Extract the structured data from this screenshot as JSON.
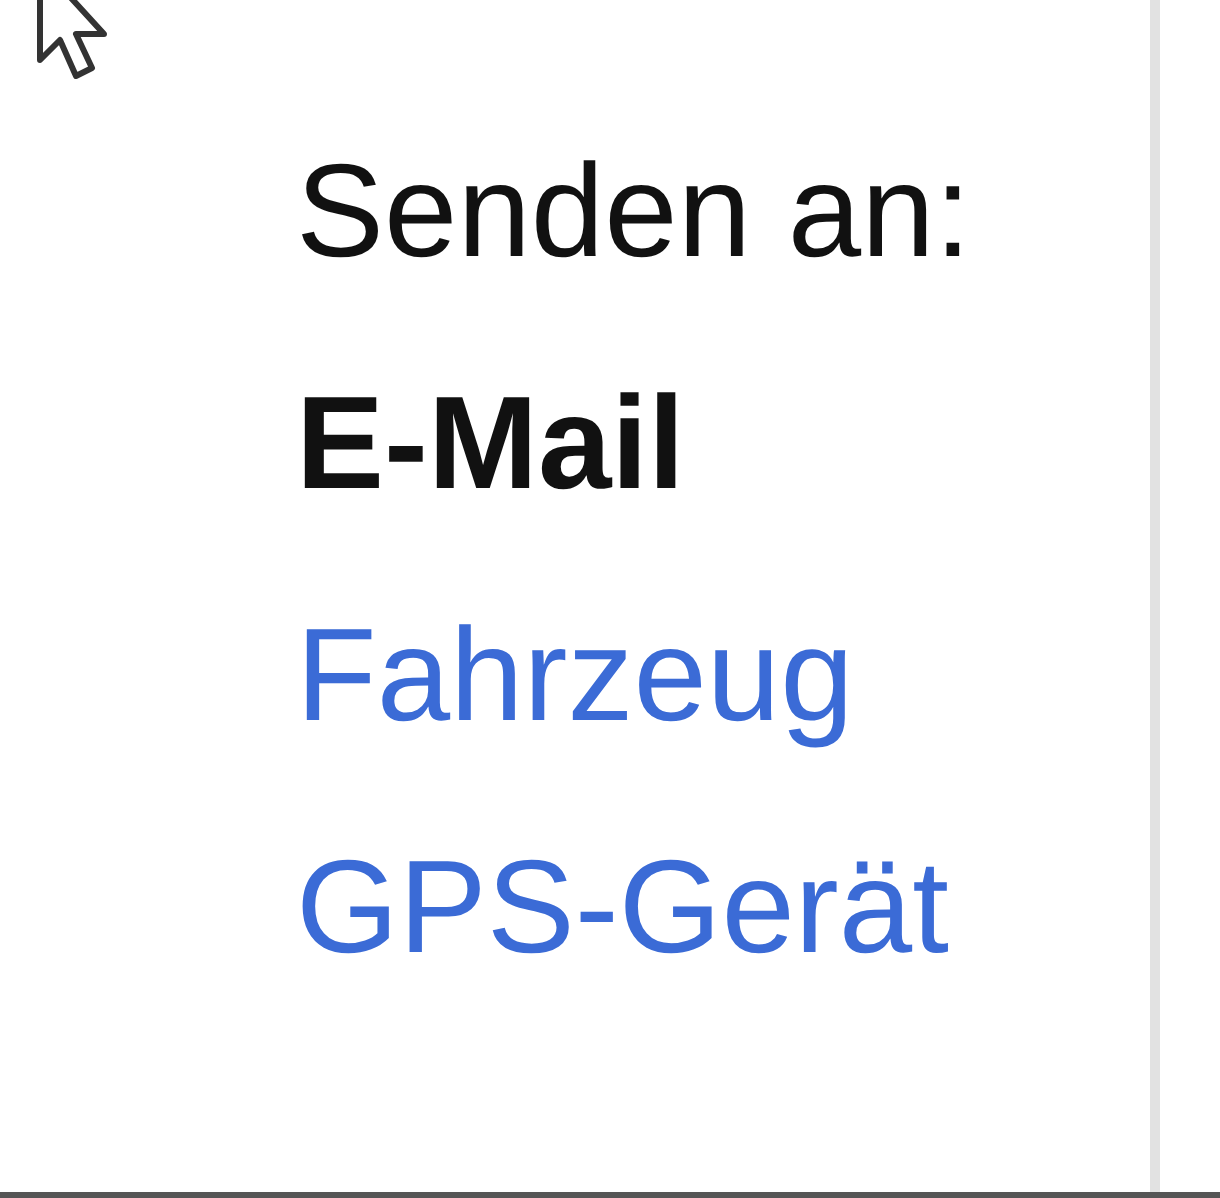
{
  "heading": "Senden an:",
  "options": [
    {
      "label": "E-Mail",
      "selected": true
    },
    {
      "label": "Fahrzeug",
      "selected": false
    },
    {
      "label": "GPS-Gerät",
      "selected": false
    }
  ]
}
